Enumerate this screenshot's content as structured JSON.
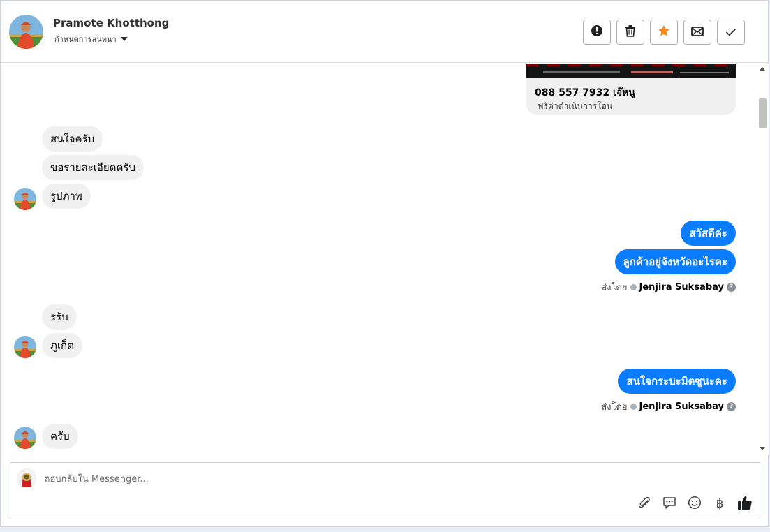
{
  "header": {
    "contact_name": "Pramote Khotthong",
    "conversation_setting": "กำหนดการสนทนา",
    "actions": [
      "alert-icon",
      "trash-icon",
      "star-icon",
      "envelope-icon",
      "check-icon"
    ],
    "star_color": "#f5871f"
  },
  "thread": {
    "card": {
      "title": "088 557 7932 เจ๊หนู",
      "subtitle": "ฟรีค่าดำเนินการโอน"
    },
    "messages": [
      {
        "dir": "in",
        "text": "สนใจครับ"
      },
      {
        "dir": "in",
        "text": "ขอรายละเอียดครับ"
      },
      {
        "dir": "in",
        "text": "รูปภาพ"
      },
      {
        "dir": "out",
        "text": "สวัสดีค่ะ"
      },
      {
        "dir": "out",
        "text": "ลูกค้าอยู่จังหวัดอะไรคะ"
      },
      {
        "dir": "in",
        "text": "รรับ"
      },
      {
        "dir": "in",
        "text": "ภูเก็ต"
      },
      {
        "dir": "out",
        "text": "สนใจกระบะมิตซูนะคะ"
      },
      {
        "dir": "in",
        "text": "ครับ"
      }
    ],
    "sent_by": [
      {
        "label": "ส่งโดย",
        "name": "Jenjira Suksabay",
        "help": "?"
      },
      {
        "label": "ส่งโดย",
        "name": "Jenjira Suksabay",
        "help": "?"
      }
    ],
    "outgoing_color": "#0a7cff"
  },
  "composer": {
    "placeholder": "ตอบกลับใน Messenger...",
    "baht_symbol": "฿",
    "tools": [
      "paperclip-icon",
      "chat-bubble-icon",
      "emoji-icon",
      "baht-icon",
      "thumbs-up-icon"
    ]
  }
}
